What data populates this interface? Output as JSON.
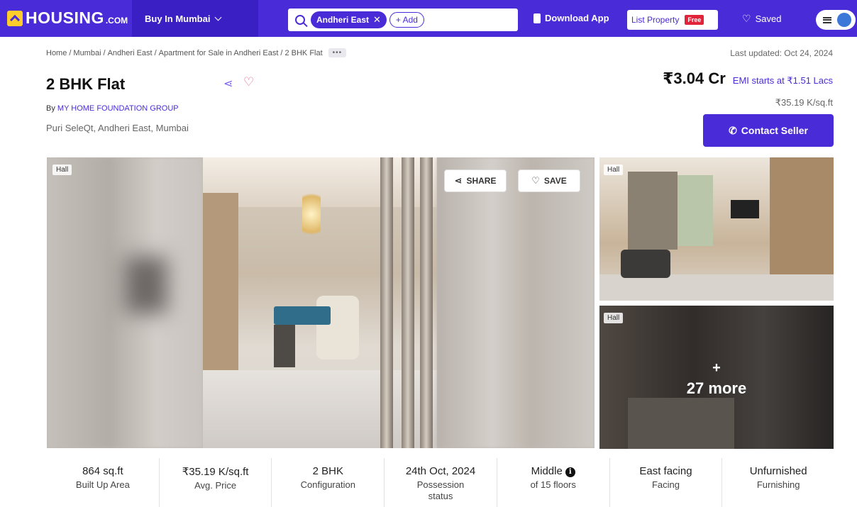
{
  "nav": {
    "logo": "HOUSING",
    "logo_suffix": ".COM",
    "buy_in": "Buy In Mumbai",
    "search_chip": "Andheri East",
    "add_chip": "+ Add",
    "download": "Download App",
    "list_property": "List Property",
    "free_badge": "Free",
    "saved": "Saved",
    "accent_color": "#4a2bd8"
  },
  "breadcrumb": {
    "items": [
      "Home",
      "Mumbai",
      "Andheri East",
      "Apartment for Sale in Andheri East",
      "2 BHK Flat"
    ],
    "more": "•••"
  },
  "last_updated": "Last updated: Oct 24, 2024",
  "listing": {
    "title": "2 BHK Flat",
    "builder_prefix": "By ",
    "builder": "MY HOME FOUNDATION GROUP",
    "locality": "Puri SeleQt, Andheri East, Mumbai",
    "price": "₹3.04 Cr",
    "emi": "EMI starts at ₹1.51 Lacs",
    "price_per_sqft": "₹35.19 K/sq.ft",
    "contact_label": "Contact Seller"
  },
  "gallery": {
    "main_tag": "Hall",
    "share": "SHARE",
    "save": "SAVE",
    "side_top_tag": "Hall",
    "side_bottom_tag": "Hall",
    "more_plus": "+",
    "more_text": "27 more"
  },
  "stats": [
    {
      "value": "864 sq.ft",
      "label": "Built Up Area"
    },
    {
      "value": "₹35.19 K/sq.ft",
      "label": "Avg. Price"
    },
    {
      "value": "2 BHK",
      "label": "Configuration"
    },
    {
      "value": "24th Oct, 2024",
      "label": "Possession status"
    },
    {
      "value": "Middle",
      "label": "of 15 floors"
    },
    {
      "value": "East facing",
      "label": "Facing"
    },
    {
      "value": "Unfurnished",
      "label": "Furnishing"
    }
  ]
}
